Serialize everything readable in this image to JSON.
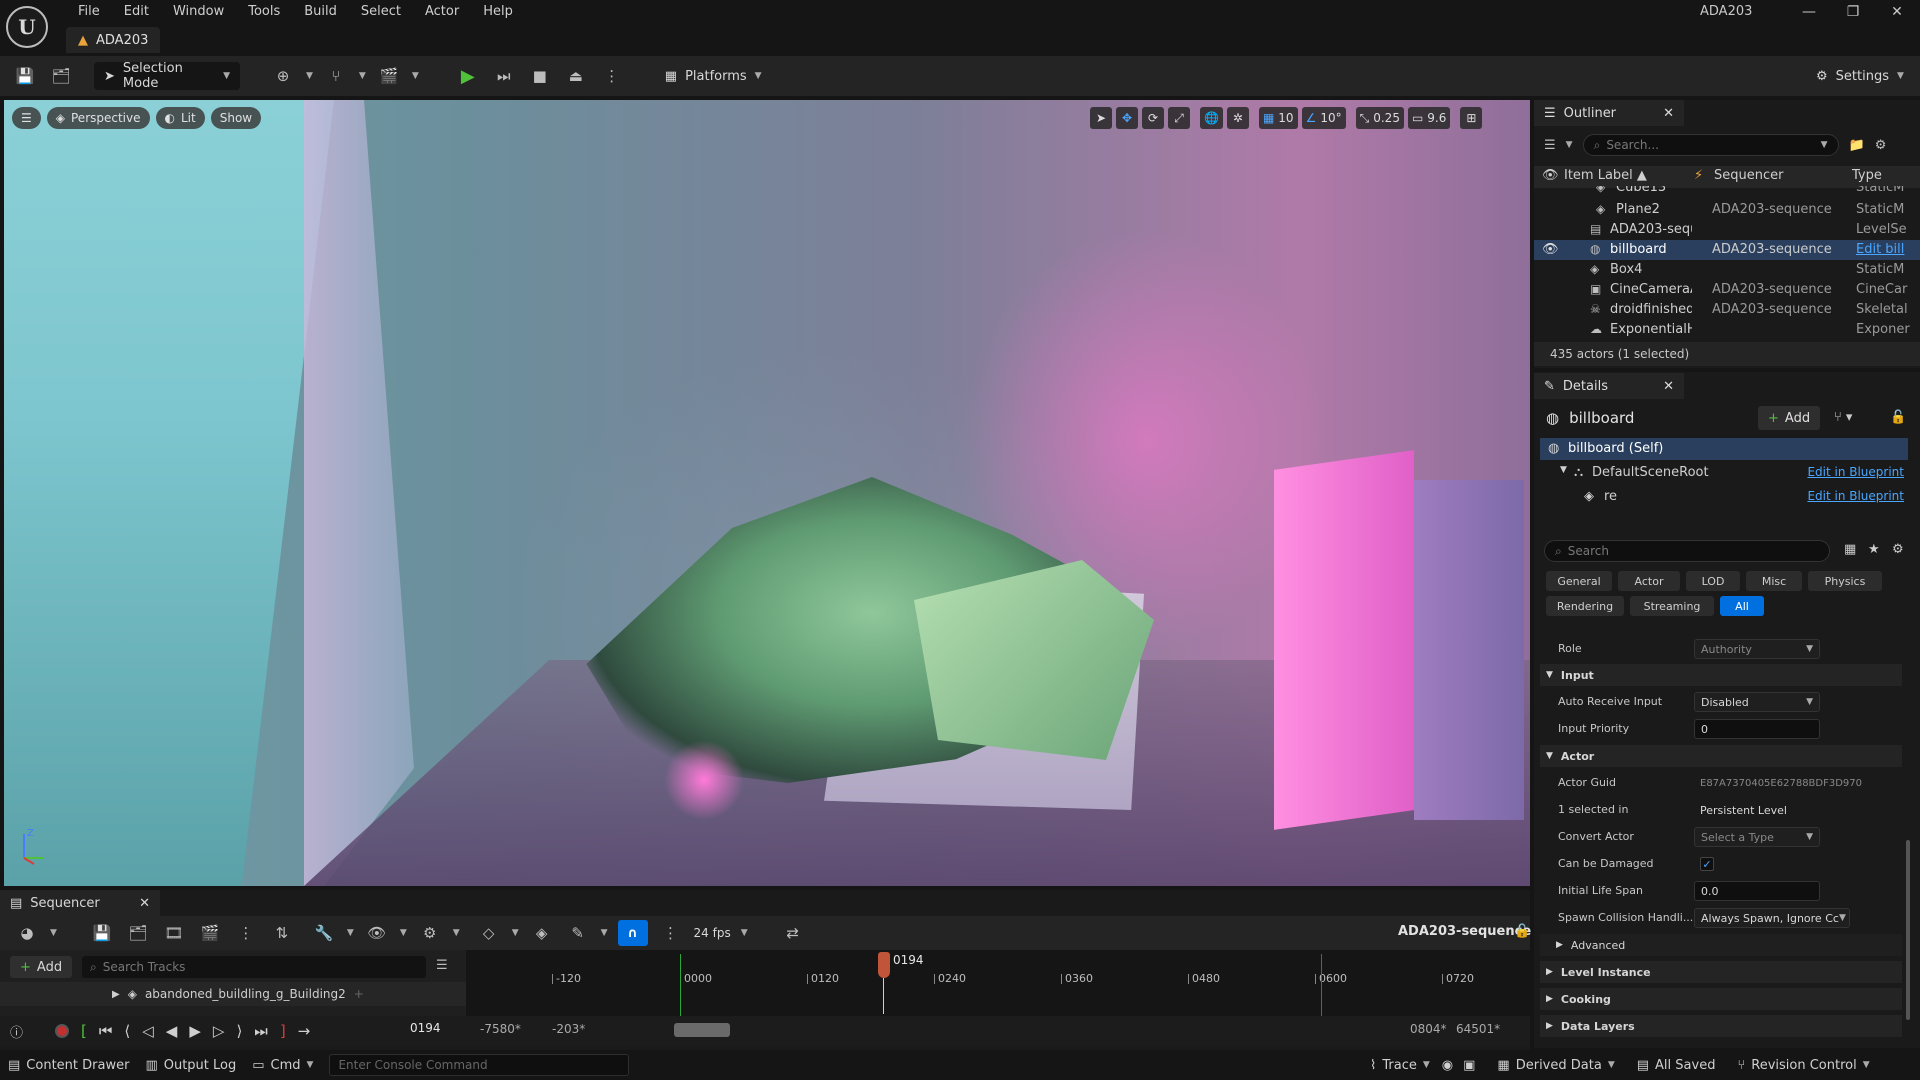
{
  "app": {
    "title": "ADA203",
    "level_tab": "ADA203",
    "logo": "U"
  },
  "menu": [
    "File",
    "Edit",
    "Window",
    "Tools",
    "Build",
    "Select",
    "Actor",
    "Help"
  ],
  "toolbar": {
    "selection_mode": "Selection Mode",
    "platforms": "Platforms",
    "settings": "Settings"
  },
  "viewport": {
    "perspective": "Perspective",
    "lit": "Lit",
    "show": "Show",
    "grid_snap": "10",
    "rotation_snap": "10°",
    "scale_snap": "0.25",
    "camera_speed": "9.6",
    "axis_z": "Z"
  },
  "sequencer": {
    "tab": "Sequencer",
    "fps": "24 fps",
    "sequence_name": "ADA203-sequence",
    "add_label": "Add",
    "search_placeholder": "Search Tracks",
    "track": "abandoned_buildling_g_Building2",
    "playhead": "0194",
    "current_frame": "0194",
    "ticks": [
      "-120",
      "0000",
      "0120",
      "0240",
      "0360",
      "0480",
      "0600",
      "0720"
    ],
    "range_start_view": "-7580*",
    "range_start": "-203*",
    "range_end": "0804*",
    "range_end_view": "64501*"
  },
  "statusbar": {
    "content_drawer": "Content Drawer",
    "output_log": "Output Log",
    "cmd": "Cmd",
    "console_placeholder": "Enter Console Command",
    "trace": "Trace",
    "derived_data": "Derived Data",
    "all_saved": "All Saved",
    "revision_control": "Revision Control"
  },
  "outliner": {
    "tab": "Outliner",
    "search_placeholder": "Search...",
    "col_label": "Item Label ▲",
    "col_sequencer": "Sequencer",
    "col_type": "Type",
    "rows": [
      {
        "label": "Cube13",
        "seq": "",
        "type": "StaticM"
      },
      {
        "label": "Plane2",
        "seq": "ADA203-sequence",
        "type": "StaticM"
      },
      {
        "label": "ADA203-sequ",
        "seq": "",
        "type": "LevelSe"
      },
      {
        "label": "billboard",
        "seq": "ADA203-sequence",
        "type": "Edit bill"
      },
      {
        "label": "Box4",
        "seq": "",
        "type": "StaticM"
      },
      {
        "label": "CineCameraA",
        "seq": "ADA203-sequence",
        "type": "CineCar"
      },
      {
        "label": "droidfinished_",
        "seq": "ADA203-sequence",
        "type": "Skeletal"
      },
      {
        "label": "ExponentialHe",
        "seq": "",
        "type": "Exponer"
      }
    ],
    "count": "435 actors (1 selected)"
  },
  "details": {
    "tab": "Details",
    "actor": "billboard",
    "add_label": "Add",
    "components": [
      {
        "label": "billboard (Self)",
        "link": ""
      },
      {
        "label": "DefaultSceneRoot",
        "link": "Edit in Blueprint"
      },
      {
        "label": "re",
        "link": "Edit in Blueprint"
      }
    ],
    "search_placeholder": "Search",
    "filters_row1": [
      "General",
      "Actor",
      "LOD",
      "Misc",
      "Physics"
    ],
    "filters_row2": [
      "Rendering",
      "Streaming",
      "All"
    ],
    "role_label": "Role",
    "role_value": "Authority",
    "cat_input": "Input",
    "auto_receive_label": "Auto Receive Input",
    "auto_receive_value": "Disabled",
    "input_priority_label": "Input Priority",
    "input_priority_value": "0",
    "cat_actor": "Actor",
    "guid_label": "Actor Guid",
    "guid_value": "E87A7370405E62788BDF3D9702",
    "selected_in_label": "1 selected in",
    "selected_in_value": "Persistent Level",
    "convert_label": "Convert Actor",
    "convert_value": "Select a Type",
    "damaged_label": "Can be Damaged",
    "damaged_value": "✓",
    "lifespan_label": "Initial Life Span",
    "lifespan_value": "0.0",
    "spawn_label": "Spawn Collision Handli...",
    "spawn_value": "Always Spawn, Ignore Cc",
    "cat_advanced": "Advanced",
    "cat_level_instance": "Level Instance",
    "cat_cooking": "Cooking",
    "cat_data_layers": "Data Layers"
  }
}
